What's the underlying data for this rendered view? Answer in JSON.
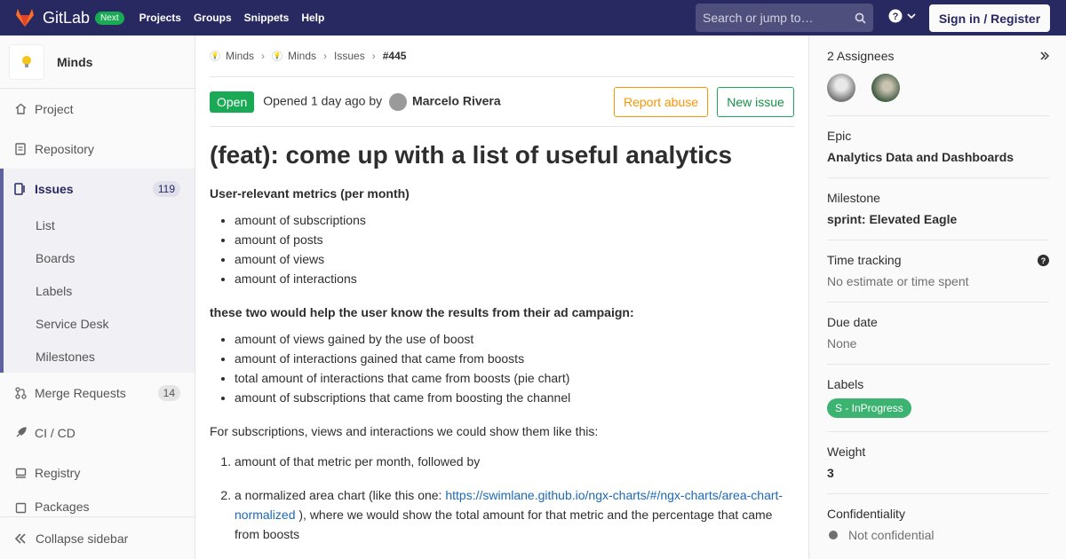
{
  "topbar": {
    "brand": "GitLab",
    "badge": "Next",
    "nav": [
      "Projects",
      "Groups",
      "Snippets",
      "Help"
    ],
    "search_placeholder": "Search or jump to…",
    "signin": "Sign in / Register"
  },
  "sidebar": {
    "project_name": "Minds",
    "items": [
      {
        "label": "Project",
        "icon": "home-icon"
      },
      {
        "label": "Repository",
        "icon": "doc-icon"
      },
      {
        "label": "Issues",
        "icon": "issues-icon",
        "count": "119"
      },
      {
        "label": "Merge Requests",
        "icon": "merge-icon",
        "count": "14"
      },
      {
        "label": "CI / CD",
        "icon": "rocket-icon"
      },
      {
        "label": "Registry",
        "icon": "container-icon"
      }
    ],
    "issues_sub": [
      "List",
      "Boards",
      "Labels",
      "Service Desk",
      "Milestones"
    ],
    "partial_item": "Packages",
    "collapse": "Collapse sidebar"
  },
  "breadcrumb": [
    "Minds",
    "Minds",
    "Issues",
    "#445"
  ],
  "issue": {
    "status": "Open",
    "opened_text": "Opened 1 day ago by",
    "author": "Marcelo Rivera",
    "report_abuse": "Report abuse",
    "new_issue": "New issue",
    "title": "(feat): come up with a list of useful analytics",
    "heading1": "User-relevant metrics (per month)",
    "list1": [
      "amount of subscriptions",
      "amount of posts",
      "amount of views",
      "amount of interactions"
    ],
    "heading2": "these two would help the user know the results from their ad campaign:",
    "list2": [
      "amount of views gained by the use of boost",
      "amount of interactions gained that came from boosts",
      "total amount of interactions that came from boosts (pie chart)",
      "amount of subscriptions that came from boosting the channel"
    ],
    "para": "For subscriptions, views and interactions we could show them like this:",
    "ol1": "amount of that metric per month, followed by",
    "ol2_pre": "a normalized area chart (like this one: ",
    "ol2_link": "https://swimlane.github.io/ngx-charts/#/ngx-charts/area-chart-normalized",
    "ol2_post": " ), where we would show the total amount for that metric and the percentage that came from boosts"
  },
  "right": {
    "assignees": "2 Assignees",
    "epic_title": "Epic",
    "epic": "Analytics Data and Dashboards",
    "milestone_title": "Milestone",
    "milestone": "sprint: Elevated Eagle",
    "time_title": "Time tracking",
    "time": "No estimate or time spent",
    "due_title": "Due date",
    "due": "None",
    "labels_title": "Labels",
    "label": "S - InProgress",
    "weight_title": "Weight",
    "weight": "3",
    "conf_title": "Confidentiality",
    "conf": "Not confidential"
  },
  "colors": {
    "topbar": "#292961",
    "open": "#1aaa55",
    "label": "#3cb371",
    "report": "#fc9403"
  }
}
